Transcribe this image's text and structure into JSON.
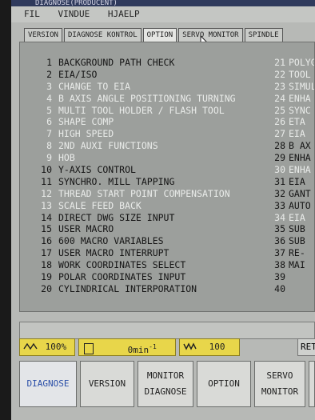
{
  "window": {
    "title": "DIAGNOSE(PRODUCENT)"
  },
  "menu": [
    "FIL",
    "VINDUE",
    "HJAELP"
  ],
  "tabs": [
    "VERSION",
    "DIAGNOSE KONTROL",
    "OPTION",
    "SERVO MONITOR",
    "SPINDLE"
  ],
  "options_left": [
    {
      "num": "1",
      "label": "BACKGROUND PATH CHECK",
      "enabled": true
    },
    {
      "num": "2",
      "label": "EIA/ISO",
      "enabled": true
    },
    {
      "num": "3",
      "label": "CHANGE TO EIA",
      "enabled": false
    },
    {
      "num": "4",
      "label": "B AXIS ANGLE POSITIONING TURNING",
      "enabled": false
    },
    {
      "num": "5",
      "label": "MULTI TOOL HOLDER / FLASH TOOL",
      "enabled": false
    },
    {
      "num": "6",
      "label": "SHAPE COMP",
      "enabled": false
    },
    {
      "num": "7",
      "label": "HIGH SPEED",
      "enabled": false
    },
    {
      "num": "8",
      "label": "2ND AUXI FUNCTIONS",
      "enabled": false
    },
    {
      "num": "9",
      "label": "HOB",
      "enabled": false
    },
    {
      "num": "10",
      "label": "Y-AXIS CONTROL",
      "enabled": true
    },
    {
      "num": "11",
      "label": "SYNCHRO. MILL TAPPING",
      "enabled": true
    },
    {
      "num": "12",
      "label": "THREAD START POINT COMPENSATION",
      "enabled": false
    },
    {
      "num": "13",
      "label": "SCALE FEED BACK",
      "enabled": false
    },
    {
      "num": "14",
      "label": "DIRECT DWG SIZE INPUT",
      "enabled": true
    },
    {
      "num": "15",
      "label": "USER MACRO",
      "enabled": true
    },
    {
      "num": "16",
      "label": "600 MACRO VARIABLES",
      "enabled": true
    },
    {
      "num": "17",
      "label": "USER MACRO INTERRUPT",
      "enabled": true
    },
    {
      "num": "18",
      "label": "WORK COORDINATES SELECT",
      "enabled": true
    },
    {
      "num": "19",
      "label": "POLAR COORDINATES INPUT",
      "enabled": true
    },
    {
      "num": "20",
      "label": "CYLINDRICAL INTERPORATION",
      "enabled": true
    }
  ],
  "options_right": [
    {
      "num": "21",
      "label": "POLYG",
      "enabled": false
    },
    {
      "num": "22",
      "label": "TOOL",
      "enabled": false
    },
    {
      "num": "23",
      "label": "SIMUL",
      "enabled": false
    },
    {
      "num": "24",
      "label": "ENHA",
      "enabled": false
    },
    {
      "num": "25",
      "label": "SYNC",
      "enabled": false
    },
    {
      "num": "26",
      "label": "ETA",
      "enabled": false
    },
    {
      "num": "27",
      "label": "EIA",
      "enabled": false
    },
    {
      "num": "28",
      "label": "B AX",
      "enabled": true
    },
    {
      "num": "29",
      "label": "ENHA",
      "enabled": true
    },
    {
      "num": "30",
      "label": "ENHA",
      "enabled": false
    },
    {
      "num": "31",
      "label": "EIA",
      "enabled": true
    },
    {
      "num": "32",
      "label": "GANT",
      "enabled": true
    },
    {
      "num": "33",
      "label": "AUTO",
      "enabled": true
    },
    {
      "num": "34",
      "label": "EIA",
      "enabled": false
    },
    {
      "num": "35",
      "label": "SUB",
      "enabled": true
    },
    {
      "num": "36",
      "label": "SUB",
      "enabled": true
    },
    {
      "num": "37",
      "label": "RE-",
      "enabled": true
    },
    {
      "num": "38",
      "label": "MAI",
      "enabled": true
    },
    {
      "num": "39",
      "label": "",
      "enabled": true
    },
    {
      "num": "40",
      "label": "",
      "enabled": true
    }
  ],
  "status": {
    "feed_override": "100%",
    "feed_rate": "0min",
    "feed_unit_exp": "-1",
    "spindle_override": "100",
    "ret_label": "RET"
  },
  "softkeys": [
    {
      "label1": "DIAGNOSE",
      "label2": "",
      "active": true
    },
    {
      "label1": "VERSION",
      "label2": "",
      "active": false
    },
    {
      "label1": "MONITOR",
      "label2": "DIAGNOSE",
      "active": false
    },
    {
      "label1": "OPTION",
      "label2": "",
      "active": false
    },
    {
      "label1": "SERVO",
      "label2": "MONITOR",
      "active": false
    }
  ],
  "colors": {
    "enabled_text": "#151515",
    "disabled_text": "#e9ebe9",
    "status_yellow": "#e8d64a",
    "active_key_text": "#2b4fa8"
  }
}
